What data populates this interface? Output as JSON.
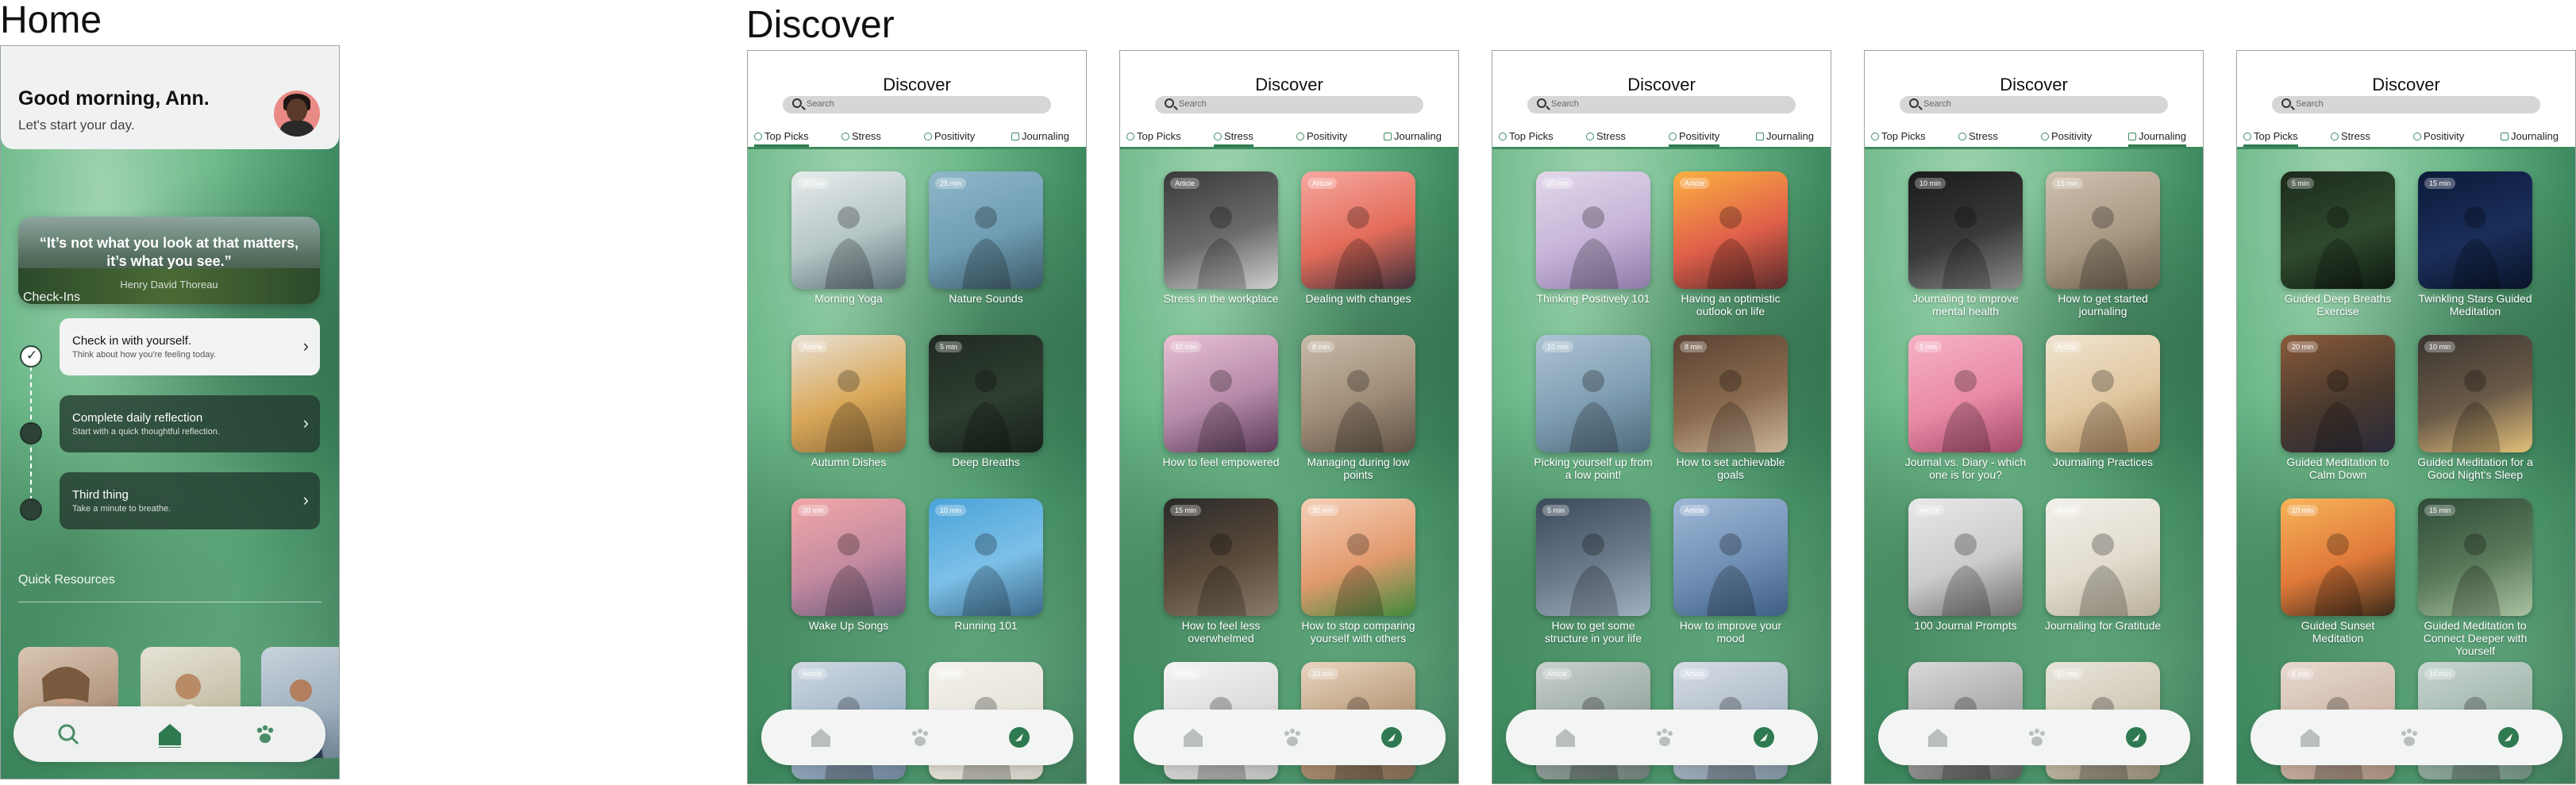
{
  "frames": {
    "home_title": "Home",
    "discover_title": "Discover"
  },
  "home": {
    "greeting": "Good morning, Ann.",
    "subgreeting": "Let's start your day.",
    "quote": {
      "text": "“It’s not what you look at that matters, it’s what you see.”",
      "author": "Henry David Thoreau"
    },
    "checkins_label": "Check-Ins",
    "checkins": [
      {
        "title": "Check in with yourself.",
        "subtitle": "Think about how you're feeling today."
      },
      {
        "title": "Complete daily reflection",
        "subtitle": "Start with a quick thoughtful reflection."
      },
      {
        "title": "Third thing",
        "subtitle": "Take a minute to breathe."
      }
    ],
    "resources_label": "Quick Resources",
    "nav_icons": [
      "search-icon",
      "home-icon",
      "paw-icon"
    ]
  },
  "discover": {
    "title": "Discover",
    "search_placeholder": "Search",
    "tabs": [
      "Top Picks",
      "Stress",
      "Positivity",
      "Journaling"
    ],
    "nav_icons": [
      "home-icon",
      "paw-icon",
      "compass-icon"
    ],
    "screens": [
      {
        "selected_tab": 0,
        "tiles": [
          {
            "badge": "10 min",
            "caption": "Morning Yoga"
          },
          {
            "badge": "25 min",
            "caption": "Nature Sounds"
          },
          {
            "badge": "Article",
            "caption": "Autumn Dishes"
          },
          {
            "badge": "5 min",
            "caption": "Deep Breaths"
          },
          {
            "badge": "30 min",
            "caption": "Wake Up Songs"
          },
          {
            "badge": "10 min",
            "caption": "Running 101"
          },
          {
            "badge": "Article",
            "caption": ""
          },
          {
            "badge": "Article",
            "caption": ""
          }
        ]
      },
      {
        "selected_tab": 1,
        "tiles": [
          {
            "badge": "Article",
            "caption": "Stress in the workplace"
          },
          {
            "badge": "Article",
            "caption": "Dealing with changes"
          },
          {
            "badge": "10 min",
            "caption": "How to feel empowered"
          },
          {
            "badge": "8 min",
            "caption": "Managing during low points"
          },
          {
            "badge": "15 min",
            "caption": "How to feel less overwhelmed"
          },
          {
            "badge": "30 min",
            "caption": "How to stop comparing yourself with others"
          },
          {
            "badge": "10 min",
            "caption": ""
          },
          {
            "badge": "23 min",
            "caption": ""
          }
        ]
      },
      {
        "selected_tab": 2,
        "tiles": [
          {
            "badge": "20 min",
            "caption": "Thinking Positively 101"
          },
          {
            "badge": "Article",
            "caption": "Having an optimistic outlook on life"
          },
          {
            "badge": "10 min",
            "caption": "Picking yourself up from a low point!"
          },
          {
            "badge": "8 min",
            "caption": "How to set achievable goals"
          },
          {
            "badge": "5 min",
            "caption": "How to get some structure in your life"
          },
          {
            "badge": "Article",
            "caption": "How to improve your mood"
          },
          {
            "badge": "Article",
            "caption": ""
          },
          {
            "badge": "Article",
            "caption": ""
          }
        ]
      },
      {
        "selected_tab": 3,
        "tiles": [
          {
            "badge": "10 min",
            "caption": "Journaling to improve mental health"
          },
          {
            "badge": "15 min",
            "caption": "How to get started journaling"
          },
          {
            "badge": "5 min",
            "caption": "Journal vs. Diary - which one is for you?"
          },
          {
            "badge": "Article",
            "caption": "Journaling Practices"
          },
          {
            "badge": "Article",
            "caption": "100 Journal Prompts"
          },
          {
            "badge": "Article",
            "caption": "Journaling for Gratitude"
          },
          {
            "badge": "",
            "caption": ""
          },
          {
            "badge": "10 min",
            "caption": ""
          }
        ]
      },
      {
        "selected_tab": 0,
        "tiles": [
          {
            "badge": "5 min",
            "caption": "Guided Deep Breaths Exercise"
          },
          {
            "badge": "15 min",
            "caption": "Twinkling Stars Guided Meditation"
          },
          {
            "badge": "20 min",
            "caption": "Guided Meditation to Calm Down"
          },
          {
            "badge": "10 min",
            "caption": "Guided Meditation for a Good Night's Sleep"
          },
          {
            "badge": "10 min",
            "caption": "Guided Sunset Meditation"
          },
          {
            "badge": "15 min",
            "caption": "Guided Meditation to Connect Deeper with Yourself"
          },
          {
            "badge": "6 min",
            "caption": ""
          },
          {
            "badge": "10 min",
            "caption": ""
          }
        ]
      }
    ]
  }
}
